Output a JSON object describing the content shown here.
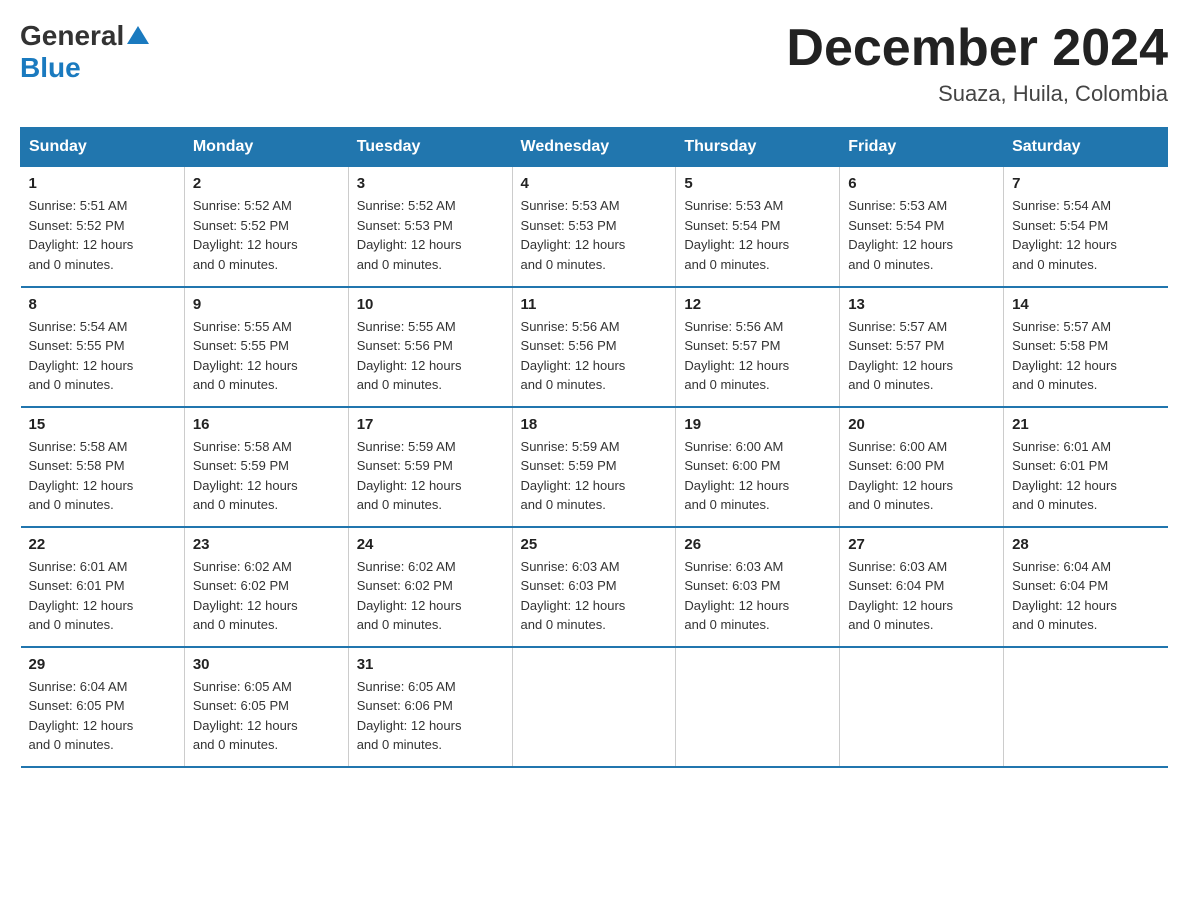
{
  "logo": {
    "general": "General",
    "blue": "Blue",
    "arrow": "▲"
  },
  "header": {
    "month_title": "December 2024",
    "location": "Suaza, Huila, Colombia"
  },
  "days_of_week": [
    "Sunday",
    "Monday",
    "Tuesday",
    "Wednesday",
    "Thursday",
    "Friday",
    "Saturday"
  ],
  "weeks": [
    [
      {
        "day": "1",
        "sunrise": "5:51 AM",
        "sunset": "5:52 PM",
        "daylight": "12 hours and 0 minutes."
      },
      {
        "day": "2",
        "sunrise": "5:52 AM",
        "sunset": "5:52 PM",
        "daylight": "12 hours and 0 minutes."
      },
      {
        "day": "3",
        "sunrise": "5:52 AM",
        "sunset": "5:53 PM",
        "daylight": "12 hours and 0 minutes."
      },
      {
        "day": "4",
        "sunrise": "5:53 AM",
        "sunset": "5:53 PM",
        "daylight": "12 hours and 0 minutes."
      },
      {
        "day": "5",
        "sunrise": "5:53 AM",
        "sunset": "5:54 PM",
        "daylight": "12 hours and 0 minutes."
      },
      {
        "day": "6",
        "sunrise": "5:53 AM",
        "sunset": "5:54 PM",
        "daylight": "12 hours and 0 minutes."
      },
      {
        "day": "7",
        "sunrise": "5:54 AM",
        "sunset": "5:54 PM",
        "daylight": "12 hours and 0 minutes."
      }
    ],
    [
      {
        "day": "8",
        "sunrise": "5:54 AM",
        "sunset": "5:55 PM",
        "daylight": "12 hours and 0 minutes."
      },
      {
        "day": "9",
        "sunrise": "5:55 AM",
        "sunset": "5:55 PM",
        "daylight": "12 hours and 0 minutes."
      },
      {
        "day": "10",
        "sunrise": "5:55 AM",
        "sunset": "5:56 PM",
        "daylight": "12 hours and 0 minutes."
      },
      {
        "day": "11",
        "sunrise": "5:56 AM",
        "sunset": "5:56 PM",
        "daylight": "12 hours and 0 minutes."
      },
      {
        "day": "12",
        "sunrise": "5:56 AM",
        "sunset": "5:57 PM",
        "daylight": "12 hours and 0 minutes."
      },
      {
        "day": "13",
        "sunrise": "5:57 AM",
        "sunset": "5:57 PM",
        "daylight": "12 hours and 0 minutes."
      },
      {
        "day": "14",
        "sunrise": "5:57 AM",
        "sunset": "5:58 PM",
        "daylight": "12 hours and 0 minutes."
      }
    ],
    [
      {
        "day": "15",
        "sunrise": "5:58 AM",
        "sunset": "5:58 PM",
        "daylight": "12 hours and 0 minutes."
      },
      {
        "day": "16",
        "sunrise": "5:58 AM",
        "sunset": "5:59 PM",
        "daylight": "12 hours and 0 minutes."
      },
      {
        "day": "17",
        "sunrise": "5:59 AM",
        "sunset": "5:59 PM",
        "daylight": "12 hours and 0 minutes."
      },
      {
        "day": "18",
        "sunrise": "5:59 AM",
        "sunset": "5:59 PM",
        "daylight": "12 hours and 0 minutes."
      },
      {
        "day": "19",
        "sunrise": "6:00 AM",
        "sunset": "6:00 PM",
        "daylight": "12 hours and 0 minutes."
      },
      {
        "day": "20",
        "sunrise": "6:00 AM",
        "sunset": "6:00 PM",
        "daylight": "12 hours and 0 minutes."
      },
      {
        "day": "21",
        "sunrise": "6:01 AM",
        "sunset": "6:01 PM",
        "daylight": "12 hours and 0 minutes."
      }
    ],
    [
      {
        "day": "22",
        "sunrise": "6:01 AM",
        "sunset": "6:01 PM",
        "daylight": "12 hours and 0 minutes."
      },
      {
        "day": "23",
        "sunrise": "6:02 AM",
        "sunset": "6:02 PM",
        "daylight": "12 hours and 0 minutes."
      },
      {
        "day": "24",
        "sunrise": "6:02 AM",
        "sunset": "6:02 PM",
        "daylight": "12 hours and 0 minutes."
      },
      {
        "day": "25",
        "sunrise": "6:03 AM",
        "sunset": "6:03 PM",
        "daylight": "12 hours and 0 minutes."
      },
      {
        "day": "26",
        "sunrise": "6:03 AM",
        "sunset": "6:03 PM",
        "daylight": "12 hours and 0 minutes."
      },
      {
        "day": "27",
        "sunrise": "6:03 AM",
        "sunset": "6:04 PM",
        "daylight": "12 hours and 0 minutes."
      },
      {
        "day": "28",
        "sunrise": "6:04 AM",
        "sunset": "6:04 PM",
        "daylight": "12 hours and 0 minutes."
      }
    ],
    [
      {
        "day": "29",
        "sunrise": "6:04 AM",
        "sunset": "6:05 PM",
        "daylight": "12 hours and 0 minutes."
      },
      {
        "day": "30",
        "sunrise": "6:05 AM",
        "sunset": "6:05 PM",
        "daylight": "12 hours and 0 minutes."
      },
      {
        "day": "31",
        "sunrise": "6:05 AM",
        "sunset": "6:06 PM",
        "daylight": "12 hours and 0 minutes."
      },
      null,
      null,
      null,
      null
    ]
  ],
  "labels": {
    "sunrise_prefix": "Sunrise: ",
    "sunset_prefix": "Sunset: ",
    "daylight_prefix": "Daylight: "
  }
}
